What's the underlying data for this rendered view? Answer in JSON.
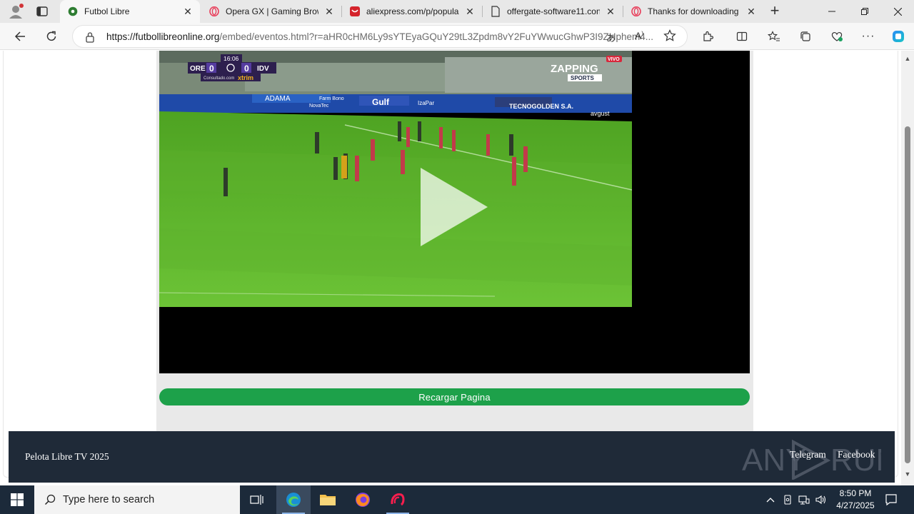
{
  "browser": {
    "tabs": [
      {
        "title": "Futbol Libre",
        "icon": "soccer-ball-icon",
        "active": true
      },
      {
        "title": "Opera GX | Gaming Brow",
        "icon": "opera-icon",
        "active": false
      },
      {
        "title": "aliexpress.com/p/popula",
        "icon": "aliexpress-icon",
        "active": false
      },
      {
        "title": "offergate-software11.con",
        "icon": "page-icon",
        "active": false
      },
      {
        "title": "Thanks for downloading",
        "icon": "opera-icon",
        "active": false
      }
    ],
    "address": {
      "url_host": "https://futbollibreonline.org",
      "url_rest": "/embed/eventos.html?r=aHR0cHM6Ly9sYTEyaGQuY29tL3Zpdm8vY2FuYWwucGhwP3I9ZHphem4..."
    }
  },
  "page": {
    "video": {
      "scoreboard": {
        "time": "16:06",
        "home": "ORE",
        "home_score": "0",
        "away_score": "0",
        "away": "IDV",
        "sponsor": "xtrim",
        "sponsor_site": "Consultado.com"
      },
      "broadcaster": {
        "live": "VIVO",
        "channel": "ZAPPING",
        "sub": "SPORTS"
      },
      "ads": [
        "ADAMA",
        "Gulf",
        "TECNOGOLDEN S.A.",
        "avgust",
        "Farm Bono",
        "NovaTec",
        "IzaPar"
      ]
    },
    "reload_button": "Recargar Pagina",
    "footer": {
      "brand": "Pelota Libre TV 2025",
      "links": [
        "Telegram",
        "Facebook"
      ],
      "watermark": "ANY RUN"
    }
  },
  "taskbar": {
    "search_placeholder": "Type here to search",
    "clock_time": "8:50 PM",
    "clock_date": "4/27/2025"
  },
  "colors": {
    "reload_green": "#1da14a",
    "footer_bg": "#1f2a38",
    "taskbar_bg": "#1c2a3a",
    "pitch_green": "#58b52a"
  }
}
